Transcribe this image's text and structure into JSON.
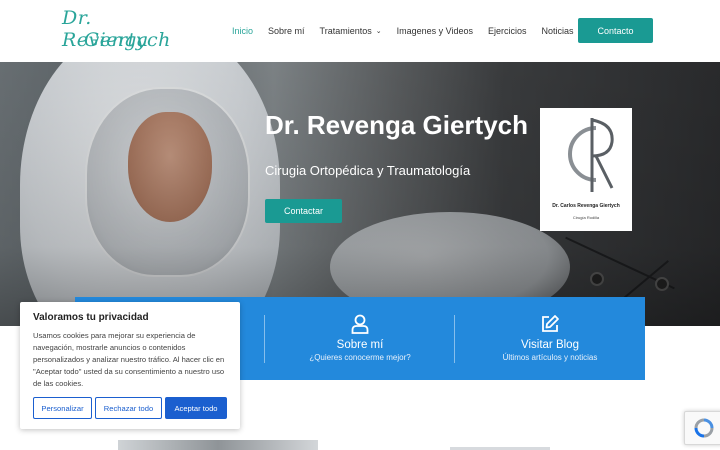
{
  "brand": {
    "logo_line1": "Dr. Revenga",
    "logo_line2": "Giertych",
    "accent_color": "#1a9a93"
  },
  "nav": {
    "items": [
      {
        "label": "Inicio",
        "active": true
      },
      {
        "label": "Sobre mí",
        "active": false
      },
      {
        "label": "Tratamientos",
        "active": false,
        "has_dropdown": true
      },
      {
        "label": "Imagenes y Videos",
        "active": false
      },
      {
        "label": "Ejercicios",
        "active": false
      },
      {
        "label": "Noticias",
        "active": false
      }
    ],
    "cta_label": "Contacto"
  },
  "hero": {
    "title": "Dr. Revenga Giertych",
    "subtitle": "Cirugia Ortopédica y Traumatología",
    "button_label": "Contactar",
    "signature_name": "Dr. Carlos Revenga Giertych",
    "signature_caption": "Cirugía Rodilla"
  },
  "infobar": {
    "color": "#2389dc",
    "items": [
      {
        "title": "Sobre mí",
        "subtitle": "¿Quieres conocerme mejor?",
        "icon": "user-icon"
      },
      {
        "title": "Visitar Blog",
        "subtitle": "Últimos artículos y noticias",
        "icon": "edit-icon"
      }
    ]
  },
  "cookie": {
    "title": "Valoramos tu privacidad",
    "text": "Usamos cookies para mejorar su experiencia de navegación, mostrarle anuncios o contenidos personalizados y analizar nuestro tráfico. Al hacer clic en \"Aceptar todo\" usted da su consentimiento a nuestro uso de las cookies.",
    "buttons": {
      "customize": "Personalizar",
      "reject": "Rechazar todo",
      "accept": "Aceptar todo"
    },
    "button_color": "#1b5fcf"
  }
}
